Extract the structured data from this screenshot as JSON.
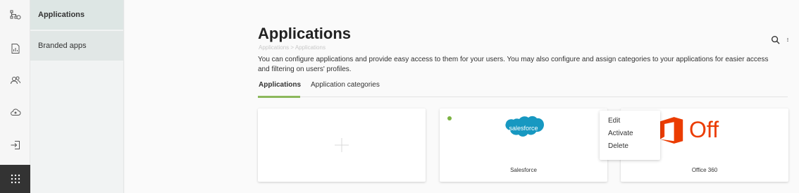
{
  "subnav": {
    "items": [
      {
        "label": "Applications"
      },
      {
        "label": "Branded apps"
      }
    ]
  },
  "page": {
    "title": "Applications",
    "breadcrumb": "Applications > Applications",
    "description": "You can configure applications and provide easy access to them for your users. You may also configure and assign categories to your applications for easier access and filtering on users' profiles."
  },
  "tabs": [
    {
      "label": "Applications",
      "active": true
    },
    {
      "label": "Application categories",
      "active": false
    }
  ],
  "cards": [
    {
      "name": "",
      "status": "none"
    },
    {
      "name": "Salesforce",
      "status": "active",
      "logo_text": "salesforce"
    },
    {
      "name": "Office 360",
      "status": "inactive",
      "logo_text": "Off"
    }
  ],
  "context_menu": {
    "items": [
      "Edit",
      "Activate",
      "Delete"
    ]
  },
  "colors": {
    "accent": "#8cb85c",
    "active_dot": "#7cb342",
    "inactive_dot": "#cccccc",
    "salesforce_blue": "#1798c1",
    "office_orange": "#eb3c00",
    "rail_active": "#333333"
  },
  "icons": {
    "rail": [
      "org-chart-icon",
      "report-icon",
      "users-icon",
      "cloud-sync-icon",
      "sign-in-icon",
      "apps-grid-icon"
    ],
    "header": [
      "search-icon",
      "more-vert-icon"
    ]
  }
}
